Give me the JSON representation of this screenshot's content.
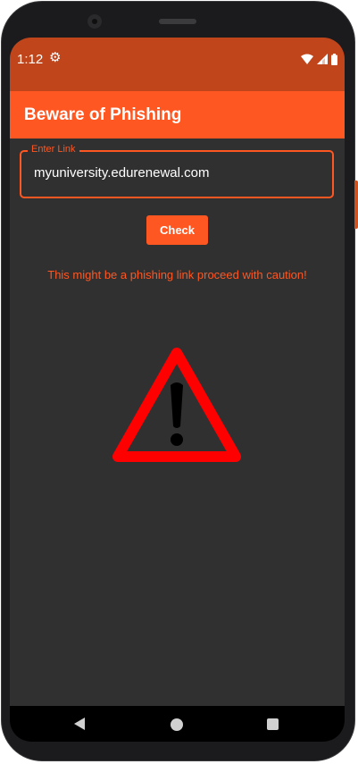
{
  "status_bar": {
    "time": "1:12",
    "icons": [
      "gear-icon",
      "wifi-icon",
      "signal-icon",
      "battery-icon"
    ]
  },
  "app_bar": {
    "title": "Beware of Phishing"
  },
  "link_field": {
    "label": "Enter Link",
    "value": "myuniversity.edurenewal.com"
  },
  "check_button": {
    "label": "Check"
  },
  "result": {
    "message": "This might be a phishing link proceed with caution!",
    "icon": "warning-triangle-icon"
  },
  "nav_bar": {
    "buttons": [
      "back-icon",
      "home-icon",
      "recents-icon"
    ]
  },
  "colors": {
    "primary": "#ff5722",
    "status_bar": "#c0451b",
    "background": "#303030",
    "warning_red": "#ff0000"
  }
}
